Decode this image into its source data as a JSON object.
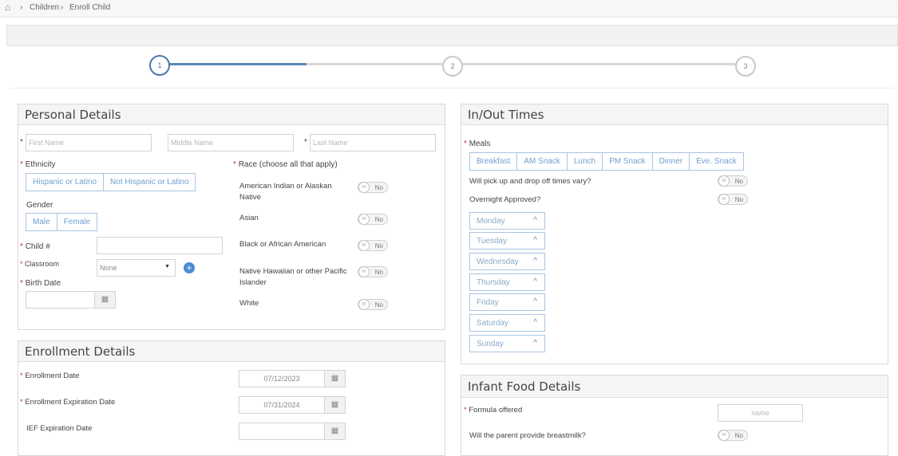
{
  "breadcrumb": {
    "home_icon": "home-icon",
    "sep": "›",
    "item1": "Children",
    "item2": "Enroll Child"
  },
  "steps": [
    "1",
    "2",
    "3"
  ],
  "personal": {
    "title": "Personal Details",
    "first_name": "First Name",
    "middle_name": "Middle Name",
    "last_name": "Last Name",
    "ethnicity_label": "Ethnicity",
    "ethnicity_options": [
      "Hispanic or Latino",
      "Not Hispanic or Latino"
    ],
    "gender_label": "Gender",
    "gender_options": [
      "Male",
      "Female"
    ],
    "child_num_label": "Child #",
    "classroom_label": "Classroom",
    "classroom_value": "None",
    "birth_date_label": "Birth Date",
    "race_label": "Race (choose all that apply)",
    "race_options": [
      "American Indian or Alaskan Native",
      "Asian",
      "Black or African American",
      "Native Hawaiian or other Pacific Islander",
      "White"
    ]
  },
  "toggle_on": "III",
  "toggle_no": "No",
  "enrollment": {
    "title": "Enrollment Details",
    "enroll_date_label": "Enrollment Date",
    "enroll_date": "07/12/2023",
    "expire_label": "Enrollment Expiration Date",
    "expire_date": "07/31/2024",
    "ief_label": "IEF Expiration Date"
  },
  "inout": {
    "title": "In/Out Times",
    "meals_label": "Meals",
    "meals": [
      "Breakfast",
      "AM Snack",
      "Lunch",
      "PM Snack",
      "Dinner",
      "Eve. Snack"
    ],
    "vary_label": "Will pick up and drop off times vary?",
    "overnight_label": "Overnight Approved?",
    "days": [
      "Monday",
      "Tuesday",
      "Wednesday",
      "Thursday",
      "Friday",
      "Saturday",
      "Sunday"
    ]
  },
  "infant": {
    "title": "Infant Food Details",
    "formula_label": "Formula offered",
    "formula_placeholder": "name",
    "breastmilk_label": "Will the parent provide breastmilk?"
  },
  "colors": {
    "accent": "#4a78ae",
    "link": "#6e9fcf",
    "required": "#c0392b"
  }
}
